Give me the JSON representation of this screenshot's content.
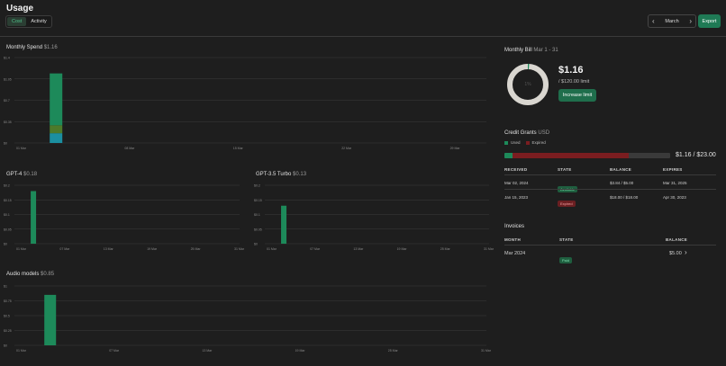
{
  "page": {
    "title": "Usage"
  },
  "tabs": [
    {
      "label": "Cost",
      "active": true
    },
    {
      "label": "Activity",
      "active": false
    }
  ],
  "month_nav": {
    "prev_icon": "chevron-left-icon",
    "label": "March",
    "next_icon": "chevron-right-icon"
  },
  "export_label": "Export",
  "colors": {
    "accent": "#1f7a55",
    "bar_green": "#1d8a5a",
    "bar_olive": "#4d7a2a",
    "bar_teal": "#1b8fa0",
    "grid": "#3a3a3a",
    "red": "#7a1d20"
  },
  "charts": {
    "monthly": {
      "title": "Monthly Spend",
      "value": "$1.16"
    },
    "gpt4": {
      "title": "GPT-4",
      "value": "$0.18"
    },
    "gpt35": {
      "title": "GPT-3.5 Turbo",
      "value": "$0.13"
    },
    "audio": {
      "title": "Audio models",
      "value": "$0.85"
    }
  },
  "chart_data": [
    {
      "type": "bar",
      "title": "Monthly Spend $1.16",
      "y_ticks": [
        "$0",
        "$0.35",
        "$0.7",
        "$1.05",
        "$1.4"
      ],
      "ylim": [
        0,
        1.4
      ],
      "x_ticks": [
        "01 Mar",
        "08 Mar",
        "15 Mar",
        "22 Mar",
        "29 Mar"
      ],
      "series": [
        {
          "color": "#1b8fa0",
          "values": [
            0.16
          ]
        },
        {
          "color": "#4d7a2a",
          "values": [
            0.13
          ]
        },
        {
          "color": "#1d8a5a",
          "values": [
            0.85
          ]
        }
      ],
      "bar_day": 2
    },
    {
      "type": "bar",
      "title": "GPT-4 $0.18",
      "y_ticks": [
        "$0",
        "$0.05",
        "$0.1",
        "$0.15",
        "$0.2"
      ],
      "ylim": [
        0,
        0.2
      ],
      "x_ticks": [
        "01 Mar",
        "07 Mar",
        "13 Mar",
        "19 Mar",
        "25 Mar",
        "31 Mar"
      ],
      "values": [
        0.18
      ],
      "bar_day": 2
    },
    {
      "type": "bar",
      "title": "GPT-3.5 Turbo $0.13",
      "y_ticks": [
        "$0",
        "$0.05",
        "$0.1",
        "$0.15",
        "$0.2"
      ],
      "ylim": [
        0,
        0.2
      ],
      "x_ticks": [
        "01 Mar",
        "07 Mar",
        "13 Mar",
        "19 Mar",
        "25 Mar",
        "31 Mar"
      ],
      "values": [
        0.13
      ],
      "bar_day": 2
    },
    {
      "type": "bar",
      "title": "Audio models $0.85",
      "y_ticks": [
        "$0",
        "$0.25",
        "$0.5",
        "$0.75",
        "$1"
      ],
      "ylim": [
        0,
        1
      ],
      "x_ticks": [
        "01 Mar",
        "07 Mar",
        "13 Mar",
        "19 Mar",
        "25 Mar",
        "31 Mar"
      ],
      "values": [
        0.85
      ],
      "bar_day": 2
    }
  ],
  "bill": {
    "title": "Monthly Bill",
    "range": "Mar 1 - 31",
    "percent_label": "1%",
    "percent_value": 1,
    "amount": "$1.16",
    "limit": "/ $120.00 limit",
    "increase_label": "Increase limit"
  },
  "credits": {
    "title": "Credit Grants",
    "unit": "USD",
    "legend_used": "Used",
    "legend_expired": "Expired",
    "used_fraction": 0.05,
    "expired_fraction": 0.7,
    "amount": "$1.16 / $23.00",
    "headers": [
      "RECEIVED",
      "STATE",
      "BALANCE",
      "EXPIRES"
    ],
    "rows": [
      {
        "received": "Mar 02, 2024",
        "state": "Available",
        "state_type": "green",
        "balance": "$3.84 / $5.00",
        "expires": "Mar 31, 2025"
      },
      {
        "received": "Jan 15, 2023",
        "state": "Expired",
        "state_type": "red",
        "balance": "$18.00 / $18.00",
        "expires": "Apr 30, 2023"
      }
    ]
  },
  "invoices": {
    "title": "Invoices",
    "headers": [
      "MONTH",
      "STATE",
      "BALANCE"
    ],
    "rows": [
      {
        "month": "Mar 2024",
        "state": "Paid",
        "balance": "$5.00",
        "chevron": "chevron-right-icon"
      }
    ]
  }
}
